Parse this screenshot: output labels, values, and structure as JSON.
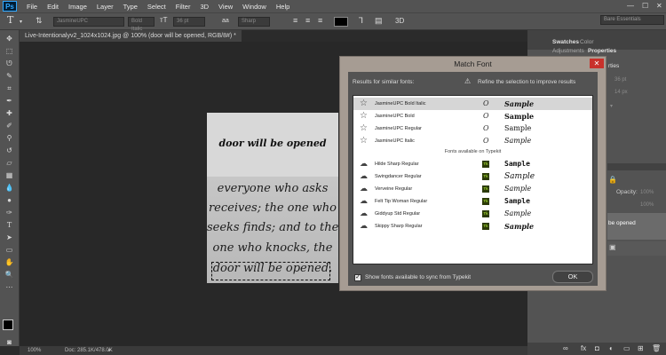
{
  "menubar": {
    "logo": "Ps",
    "items": [
      "File",
      "Edit",
      "Image",
      "Layer",
      "Type",
      "Select",
      "Filter",
      "3D",
      "View",
      "Window",
      "Help"
    ]
  },
  "options": {
    "font_family": "JasmineUPC",
    "font_style": "Bold Italic",
    "font_size": "36 pt",
    "antialias": "Sharp",
    "label_3d": "3D",
    "color_swatch": "#000000"
  },
  "workspace": "Bare Essentials",
  "document": {
    "tab_title": "Live-Intentionalyv2_1024x1024.jpg @ 100% (door will be opened, RGB/8#) *",
    "image_heading": "door will be opened",
    "image_lines": [
      "everyone who asks",
      "receives; the one who",
      "seeks finds; and to the",
      "one who knocks, the",
      "door will be opened."
    ]
  },
  "status": {
    "zoom": "100%",
    "doc": "Doc: 285.1K/478.0K"
  },
  "right_panel": {
    "tabs_top": [
      "Swatches",
      "Color"
    ],
    "tabs_bottom": [
      "Adjustments",
      "Properties"
    ],
    "props_label": "rties",
    "field1": "36 pt",
    "field2": "14 px",
    "opacity_label": "Opacity:",
    "opacity_value": "100%",
    "fill_value": "100%",
    "layer_name": "be opened"
  },
  "dialog": {
    "title": "Match Font",
    "results_label": "Results for similar fonts:",
    "refine": "Refine the selection to improve results",
    "local_fonts": [
      {
        "name": "JasmineUPC Bold Italic",
        "sample": "Sample",
        "selected": true
      },
      {
        "name": "JasmineUPC Bold",
        "sample": "Sample",
        "selected": false
      },
      {
        "name": "JasmineUPC Regular",
        "sample": "Sample",
        "selected": false
      },
      {
        "name": "JasmineUPC Italic",
        "sample": "Sample",
        "selected": false
      }
    ],
    "typekit_header": "Fonts available on Typekit",
    "typekit_fonts": [
      {
        "name": "Hilde Sharp Regular",
        "sample": "Sample"
      },
      {
        "name": "Swingdancer Regular",
        "sample": "Sample"
      },
      {
        "name": "Verveine Regular",
        "sample": "Sample"
      },
      {
        "name": "Felt Tip Woman Regular",
        "sample": "Sample"
      },
      {
        "name": "Giddyup Std Regular",
        "sample": "Sample"
      },
      {
        "name": "Skippy Sharp Regular",
        "sample": "Sample"
      }
    ],
    "type_glyph": "O",
    "tk_badge": "Tk",
    "show_sync_label": "Show fonts available to sync from Typekit",
    "ok_label": "OK"
  }
}
